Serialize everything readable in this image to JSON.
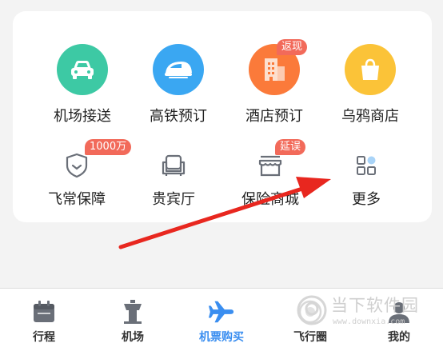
{
  "grid": {
    "row1": [
      {
        "label": "机场接送",
        "icon": "car-icon",
        "color": "#3dc9a4"
      },
      {
        "label": "高铁预订",
        "icon": "train-icon",
        "color": "#3aa7f2"
      },
      {
        "label": "酒店预订",
        "icon": "hotel-icon",
        "color": "#fb7a3a",
        "badge": "返现"
      },
      {
        "label": "乌鸦商店",
        "icon": "shopping-bag-icon",
        "color": "#fbc338"
      }
    ],
    "row2": [
      {
        "label": "飞常保障",
        "icon": "shield-icon",
        "badge": "1000万"
      },
      {
        "label": "贵宾厅",
        "icon": "sofa-icon"
      },
      {
        "label": "保险商城",
        "icon": "store-icon",
        "badge": "延误"
      },
      {
        "label": "更多",
        "icon": "more-grid-icon"
      }
    ]
  },
  "tabbar": [
    {
      "label": "行程",
      "icon": "calendar-icon",
      "active": false
    },
    {
      "label": "机场",
      "icon": "tower-icon",
      "active": false
    },
    {
      "label": "机票购买",
      "icon": "airplane-icon",
      "active": true
    },
    {
      "label": "飞行圈",
      "icon": "circle-icon",
      "active": false
    },
    {
      "label": "我的",
      "icon": "profile-icon",
      "active": false
    }
  ],
  "watermark": {
    "text": "当下软件园",
    "url": "www.downxia.com"
  },
  "colors": {
    "accent": "#3a8ef0",
    "badge": "#f26a5a",
    "arrow": "#e8271f",
    "icon_gray": "#6a6f78"
  }
}
